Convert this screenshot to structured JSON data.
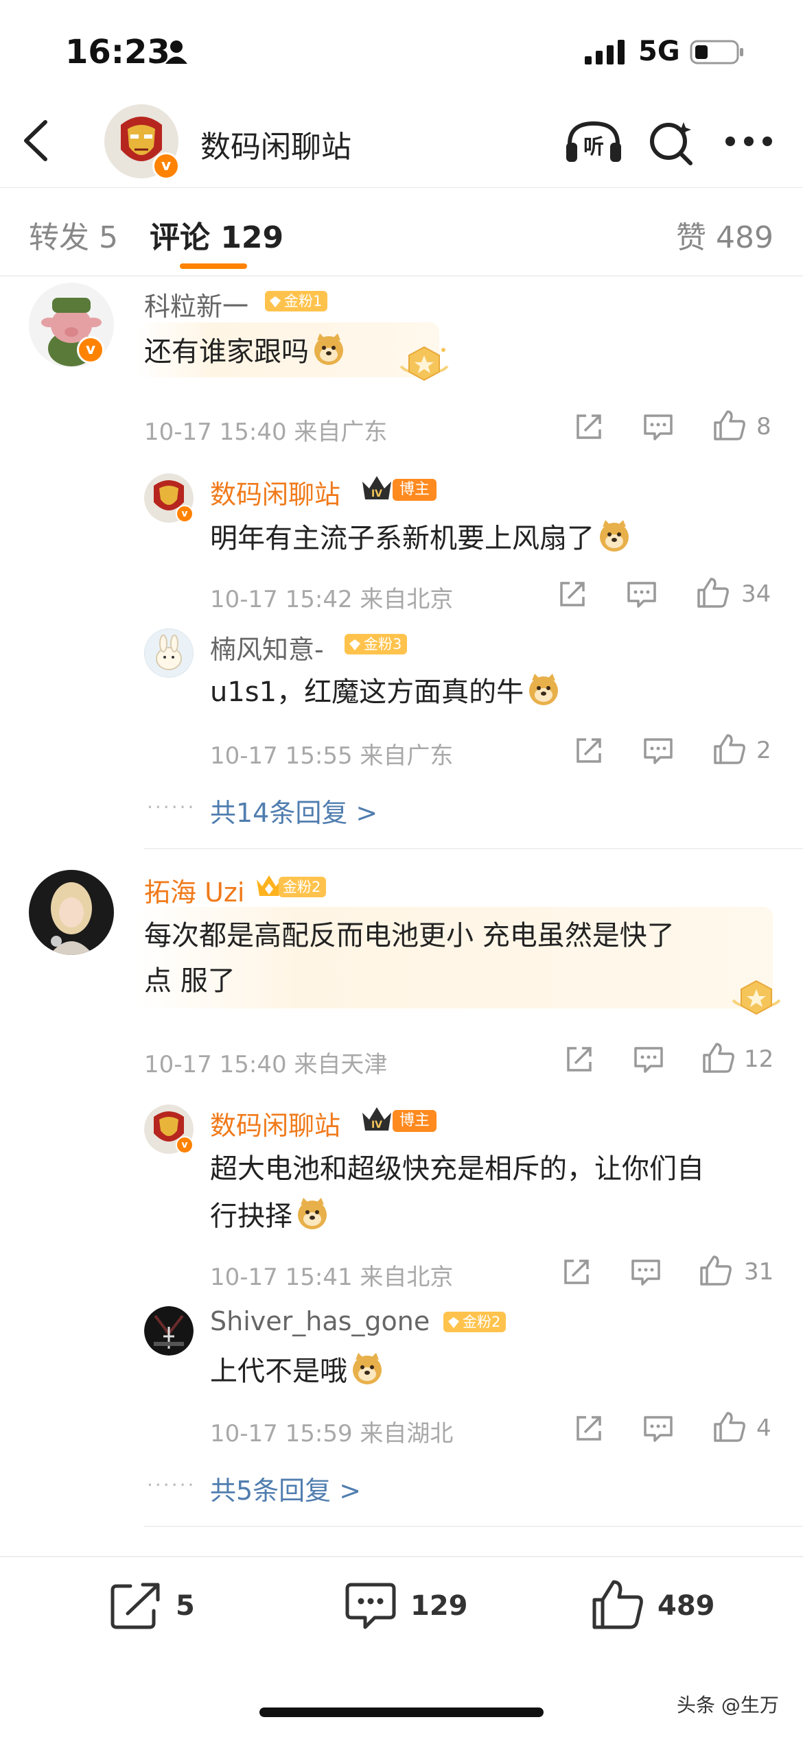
{
  "status_bar": {
    "time": "16:23",
    "network": "5G"
  },
  "header": {
    "title": "数码闲聊站"
  },
  "tabs": [
    {
      "label": "转发 5"
    },
    {
      "label": "评论 129"
    },
    {
      "label": "赞 489"
    }
  ],
  "comments": [
    {
      "user": "科粒新一",
      "fan_badge": "金粉1",
      "text": "还有谁家跟吗",
      "meta": "10-17 15:40 来自广东",
      "likes": "8",
      "replies": [
        {
          "user": "数码闲聊站",
          "badge": "博主",
          "text": "明年有主流子系新机要上风扇了",
          "meta": "10-17 15:42 来自北京",
          "likes": "34"
        },
        {
          "user": "楠风知意-",
          "fan_badge": "金粉3",
          "text": "u1s1，红魔这方面真的牛",
          "meta": "10-17 15:55 来自广东",
          "likes": "2"
        }
      ],
      "more": "共14条回复 >"
    },
    {
      "user": "拓海 Uzi",
      "fan_badge": "金粉2",
      "text_line1": "每次都是高配反而电池更小 充电虽然是快了",
      "text_line2": "点 服了",
      "meta": "10-17 15:40 来自天津",
      "likes": "12",
      "replies": [
        {
          "user": "数码闲聊站",
          "badge": "博主",
          "text_line1": "超大电池和超级快充是相斥的，让你们自",
          "text_line2": "行抉择",
          "meta": "10-17 15:41 来自北京",
          "likes": "31"
        },
        {
          "user": "Shiver_has_gone",
          "fan_badge": "金粉2",
          "text": "上代不是哦",
          "meta": "10-17 15:59 来自湖北",
          "likes": "4"
        }
      ],
      "more": "共5条回复 >"
    }
  ],
  "bottom_bar": {
    "reposts": "5",
    "comments": "129",
    "likes": "489"
  },
  "watermark": "头条 @生万",
  "colors": {
    "accent": "#ff8200",
    "link": "#507daf",
    "fan_badge": "#ffc34d"
  }
}
